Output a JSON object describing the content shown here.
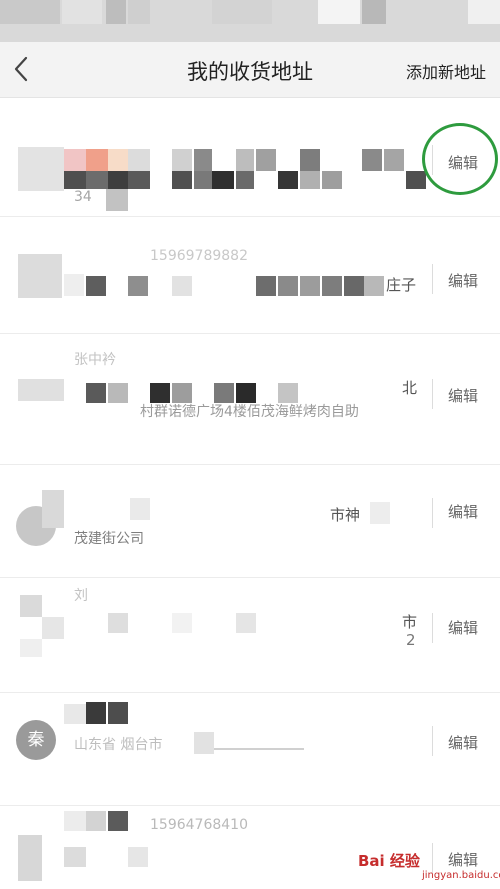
{
  "nav": {
    "back_icon": "chevron-left-icon",
    "title": "我的收货地址",
    "add_label": "添加新地址"
  },
  "addresses": [
    {
      "edit_label": "编辑",
      "line1": "",
      "line2": "",
      "line3": "34"
    },
    {
      "edit_label": "编辑",
      "line1": "15969789882",
      "line2": "庄子",
      "line3": ""
    },
    {
      "edit_label": "编辑",
      "line1": "张中衿",
      "line2": "北",
      "line3": "村群诺德广场4楼佰茂海鲜烤肉自助"
    },
    {
      "edit_label": "编辑",
      "line1": "市神",
      "line2": "",
      "line3": "茂建街公司"
    },
    {
      "edit_label": "编辑",
      "line1": "刘",
      "line2": "市",
      "line3": "2"
    },
    {
      "edit_label": "编辑",
      "line1": "",
      "line2": "山东省 烟台市",
      "line3": "",
      "avatar": "秦"
    },
    {
      "edit_label": "编辑",
      "line1": "15964768410",
      "line2": "",
      "line3": ""
    }
  ],
  "watermark": {
    "text": "Bai 经验",
    "sub": "jingyan.baidu.com"
  },
  "colors": {
    "highlight_circle": "#2e9b3e",
    "nav_bg": "#f3f3f3"
  }
}
